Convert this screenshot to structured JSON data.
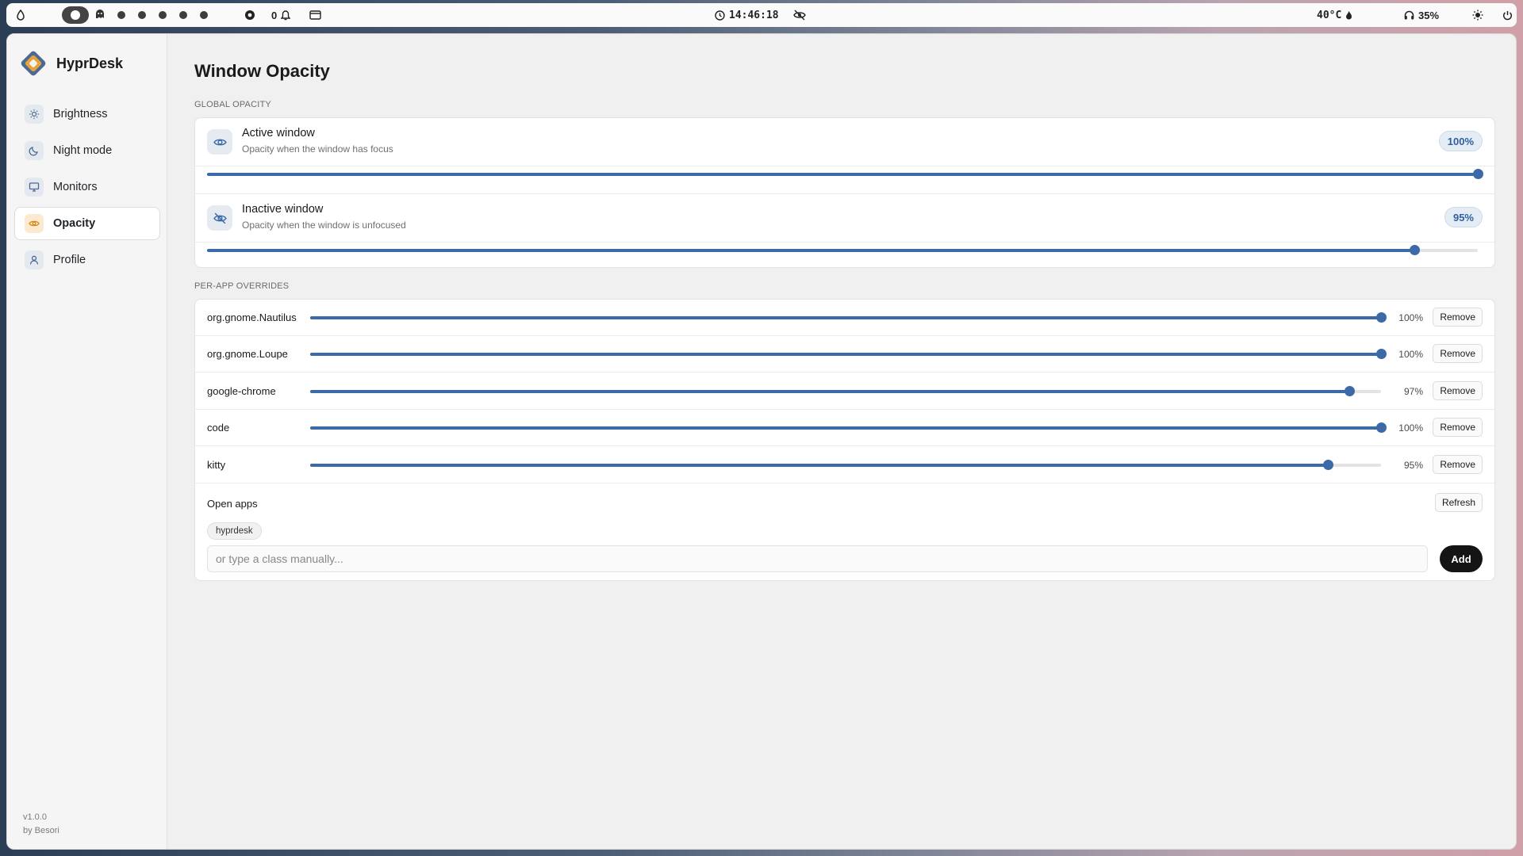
{
  "topbar": {
    "notif_count": "0",
    "clock": "14:46:18",
    "temperature": "40°C",
    "volume": "35%"
  },
  "app": {
    "name": "HyprDesk",
    "version": "v1.0.0",
    "author": "by Besori"
  },
  "sidebar": {
    "items": [
      {
        "label": "Brightness",
        "icon": "sun-icon"
      },
      {
        "label": "Night mode",
        "icon": "moon-icon"
      },
      {
        "label": "Monitors",
        "icon": "monitor-icon"
      },
      {
        "label": "Opacity",
        "icon": "eye-icon",
        "active": true
      },
      {
        "label": "Profile",
        "icon": "user-icon"
      }
    ]
  },
  "main": {
    "title": "Window Opacity",
    "global_label": "Global opacity",
    "active": {
      "title": "Active window",
      "subtitle": "Opacity when the window has focus",
      "value_label": "100%",
      "value": 1.0
    },
    "inactive": {
      "title": "Inactive window",
      "subtitle": "Opacity when the window is unfocused",
      "value_label": "95%",
      "value": 0.95
    },
    "overrides_label": "Per-app overrides",
    "overrides": [
      {
        "app": "org.gnome.Nautilus",
        "value_label": "100%",
        "value": 1.0,
        "remove_label": "Remove"
      },
      {
        "app": "org.gnome.Loupe",
        "value_label": "100%",
        "value": 1.0,
        "remove_label": "Remove"
      },
      {
        "app": "google-chrome",
        "value_label": "97%",
        "value": 0.97,
        "remove_label": "Remove"
      },
      {
        "app": "code",
        "value_label": "100%",
        "value": 1.0,
        "remove_label": "Remove"
      },
      {
        "app": "kitty",
        "value_label": "95%",
        "value": 0.95,
        "remove_label": "Remove"
      }
    ],
    "open_apps_label": "Open apps",
    "refresh_label": "Refresh",
    "open_apps": [
      "hyprdesk"
    ],
    "class_input_placeholder": "or type a class manually...",
    "add_label": "Add"
  },
  "colors": {
    "accent": "#3c6aa8",
    "active_nav_icon_bg": "#fbead0",
    "primary_button": "#141414"
  }
}
